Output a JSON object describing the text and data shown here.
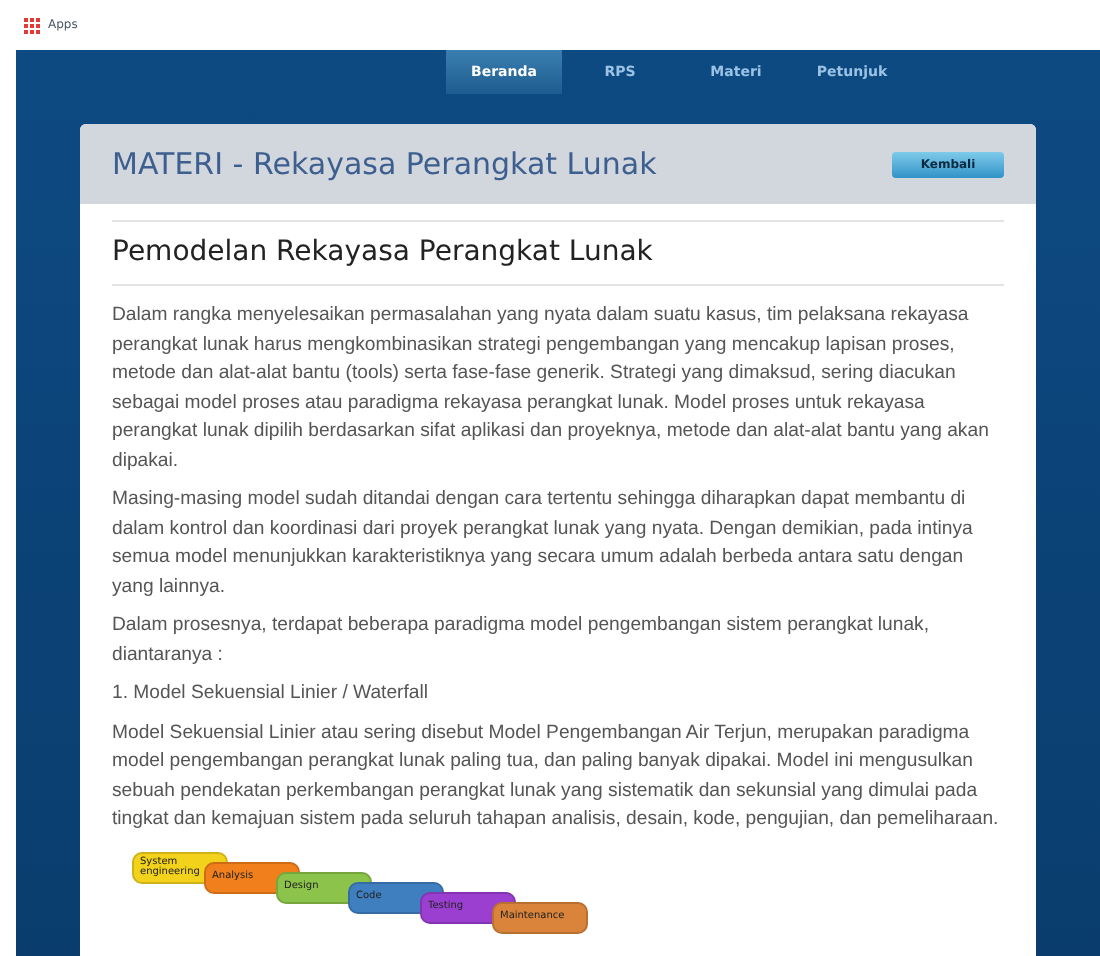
{
  "bookmarks_bar": {
    "apps_label": "Apps"
  },
  "nav": [
    {
      "label": "Beranda",
      "selected": true
    },
    {
      "label": "RPS",
      "selected": false
    },
    {
      "label": "Materi",
      "selected": false
    },
    {
      "label": "Petunjuk",
      "selected": false
    }
  ],
  "panel": {
    "title": "MATERI - Rekayasa Perangkat Lunak",
    "back_button": "Kembali"
  },
  "article": {
    "heading": "Pemodelan Rekayasa Perangkat Lunak",
    "paragraphs": [
      "Dalam rangka menyelesaikan permasalahan yang nyata dalam suatu kasus, tim pelaksana rekayasa perangkat lunak harus mengkombinasikan strategi pengembangan yang mencakup lapisan proses, metode dan alat-alat bantu (tools) serta fase-fase generik. Strategi yang dimaksud, sering diacukan sebagai model proses atau paradigma rekayasa perangkat lunak. Model proses untuk rekayasa perangkat lunak dipilih berdasarkan sifat aplikasi dan proyeknya, metode dan alat-alat bantu yang akan dipakai.",
      "Masing-masing model sudah ditandai dengan cara tertentu sehingga diharapkan dapat membantu di dalam kontrol dan koordinasi dari proyek perangkat lunak yang nyata. Dengan demikian, pada intinya semua model menunjukkan karakteristiknya yang secara umum adalah berbeda antara satu dengan yang lainnya.",
      "Dalam prosesnya, terdapat beberapa paradigma model pengembangan sistem perangkat lunak, diantaranya :",
      "1. Model Sekuensial Linier / Waterfall",
      "Model Sekuensial Linier atau sering disebut Model Pengembangan Air Terjun, merupakan paradigma model pengembangan perangkat lunak paling tua, dan paling banyak dipakai. Model ini mengusulkan sebuah pendekatan perkembangan perangkat lunak yang sistematik dan sekunsial yang dimulai pada tingkat dan kemajuan sistem pada seluruh tahapan analisis, desain, kode, pengujian, dan pemeliharaan."
    ],
    "waterfall": [
      {
        "label": "System engineering",
        "color": "#f2d21a"
      },
      {
        "label": "Analysis",
        "color": "#f07f1c"
      },
      {
        "label": "Design",
        "color": "#8cc34a"
      },
      {
        "label": "Code",
        "color": "#3f7fc0"
      },
      {
        "label": "Testing",
        "color": "#9b3fd1"
      },
      {
        "label": "Maintenance",
        "color": "#d9843a"
      }
    ]
  }
}
